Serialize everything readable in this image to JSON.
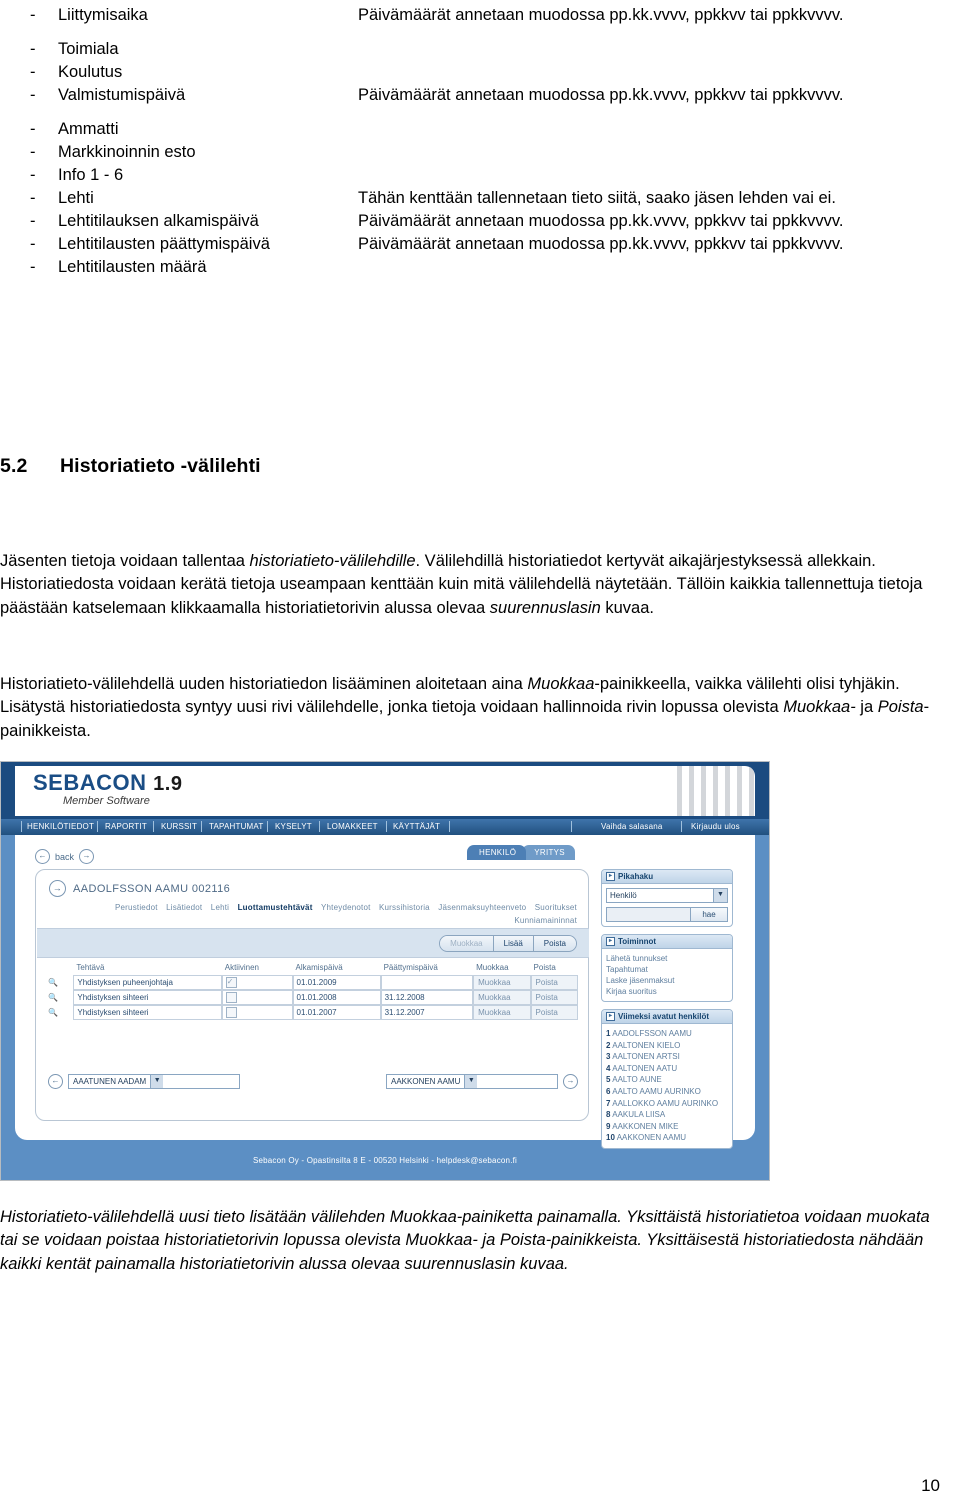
{
  "field_list": [
    {
      "dash": "-",
      "label": "Liittymisaika",
      "desc": "Päivämäärät annetaan muodossa pp.kk.vvvv, ppkkvv tai ppkkvvvv."
    },
    {
      "dash": "-",
      "label": "Toimiala",
      "desc": ""
    },
    {
      "dash": "-",
      "label": "Koulutus",
      "desc": ""
    },
    {
      "dash": "-",
      "label": "Valmistumispäivä",
      "desc": "Päivämäärät annetaan muodossa pp.kk.vvvv, ppkkvv tai ppkkvvvv."
    },
    {
      "dash": "-",
      "label": "Ammatti",
      "desc": ""
    },
    {
      "dash": "-",
      "label": "Markkinoinnin esto",
      "desc": ""
    },
    {
      "dash": "-",
      "label": "Info 1 - 6",
      "desc": ""
    },
    {
      "dash": "-",
      "label": "Lehti",
      "desc": "Tähän kenttään tallennetaan tieto siitä, saako jäsen lehden vai ei."
    },
    {
      "dash": "-",
      "label": "Lehtitilauksen alkamispäivä",
      "desc": "Päivämäärät annetaan muodossa pp.kk.vvvv, ppkkvv tai ppkkvvvv."
    },
    {
      "dash": "-",
      "label": "Lehtitilausten päättymispäivä",
      "desc": "Päivämäärät annetaan muodossa pp.kk.vvvv, ppkkvv tai ppkkvvvv."
    },
    {
      "dash": "-",
      "label": "Lehtitilausten määrä",
      "desc": ""
    }
  ],
  "heading": {
    "number": "5.2",
    "title": "Historiatieto -välilehti"
  },
  "paragraphs": {
    "p1_a": "Jäsenten tietoja voidaan tallentaa ",
    "p1_i1": "historiatieto-välilehdille",
    "p1_b": ". Välilehdillä historiatiedot kertyvät aikajärjestyksessä allekkain. Historiatiedosta voidaan kerätä tietoja useampaan kenttään kuin mitä välilehdellä näytetään. Tällöin kaikkia tallennettuja tietoja päästään katselemaan klikkaamalla historiatietorivin alussa olevaa ",
    "p1_i2": "suurennuslasin",
    "p1_c": " kuvaa.",
    "p2_a": "Historiatieto-välilehdellä uuden historiatiedon lisääminen aloitetaan aina ",
    "p2_i1": "Muokkaa",
    "p2_b": "-painikkeella, vaikka välilehti olisi tyhjäkin. Lisätystä historiatiedosta syntyy uusi rivi välilehdelle, jonka tietoja voidaan hallinnoida rivin lopussa olevista ",
    "p2_i2": "Muokkaa-",
    "p2_c": " ja ",
    "p2_i3": "Poista",
    "p2_d": "-painikkeista."
  },
  "screenshot": {
    "logo": {
      "name": "SEBACON",
      "version": "1.9",
      "tagline": "Member Software"
    },
    "nav": {
      "left_items": [
        "HENKILÖTIEDOT",
        "RAPORTIT",
        "KURSSIT",
        "TAPAHTUMAT",
        "KYSELYT",
        "LOMAKKEET",
        "KÄYTTÄJÄT"
      ],
      "right_items": [
        "Vaihda salasana",
        "Kirjaudu ulos"
      ]
    },
    "back_label": "back",
    "entity_tabs": [
      {
        "label": "HENKILÖ",
        "active": true
      },
      {
        "label": "YRITYS",
        "active": false
      }
    ],
    "person_title": "AADOLFSSON AAMU 002116",
    "subtabs": [
      {
        "label": "Perustiedot",
        "active": false
      },
      {
        "label": "Lisätiedot",
        "active": false
      },
      {
        "label": "Lehti",
        "active": false
      },
      {
        "label": "Luottamustehtävät",
        "active": true
      },
      {
        "label": "Yhteydenotot",
        "active": false
      },
      {
        "label": "Kurssihistoria",
        "active": false
      },
      {
        "label": "Jäsenmaksuyhteenveto",
        "active": false
      },
      {
        "label": "Suoritukset",
        "active": false
      },
      {
        "label": "Kunniamaininnat",
        "active": false
      }
    ],
    "action_buttons": [
      {
        "label": "Muokkaa",
        "disabled": true
      },
      {
        "label": "Lisää",
        "disabled": false
      },
      {
        "label": "Poista",
        "disabled": false
      }
    ],
    "table": {
      "headers": [
        "Tehtävä",
        "Aktiivinen",
        "Alkamispäivä",
        "Päättymispäivä",
        "Muokkaa",
        "Poista"
      ],
      "rows": [
        {
          "tehtava": "Yhdistyksen puheenjohtaja",
          "aktiivinen": true,
          "alkamis": "01.01.2009",
          "paattymis": "",
          "muokkaa": "Muokkaa",
          "poista": "Poista"
        },
        {
          "tehtava": "Yhdistyksen sihteeri",
          "aktiivinen": false,
          "alkamis": "01.01.2008",
          "paattymis": "31.12.2008",
          "muokkaa": "Muokkaa",
          "poista": "Poista"
        },
        {
          "tehtava": "Yhdistyksen sihteeri",
          "aktiivinen": false,
          "alkamis": "01.01.2007",
          "paattymis": "31.12.2007",
          "muokkaa": "Muokkaa",
          "poista": "Poista"
        }
      ]
    },
    "prev_select": "AAATUNEN AADAM",
    "next_select": "AAKKONEN AAMU",
    "panels": {
      "pikahaku": {
        "title": "Pikahaku",
        "select_value": "Henkilö",
        "search_value": "",
        "button": "hae"
      },
      "toiminnot": {
        "title": "Toiminnot",
        "links": [
          "Lähetä tunnukset",
          "Tapahtumat",
          "Laske jäsenmaksut",
          "Kirjaa suoritus"
        ]
      },
      "recent": {
        "title": "Viimeksi avatut henkilöt",
        "items": [
          {
            "n": "1",
            "name": "AADOLFSSON AAMU"
          },
          {
            "n": "2",
            "name": "AALTONEN KIELO"
          },
          {
            "n": "3",
            "name": "AALTONEN ARTSI"
          },
          {
            "n": "4",
            "name": "AALTONEN AATU"
          },
          {
            "n": "5",
            "name": "AALTO AUNE"
          },
          {
            "n": "6",
            "name": "AALTO AAMU AURINKO"
          },
          {
            "n": "7",
            "name": "AALLOKKO AAMU AURINKO"
          },
          {
            "n": "8",
            "name": "AAKULA LIISA"
          },
          {
            "n": "9",
            "name": "AAKKONEN MIKE"
          },
          {
            "n": "10",
            "name": "AAKKONEN AAMU"
          }
        ]
      }
    },
    "footer": "Sebacon Oy - Opastinsilta 8 E - 00520 Helsinki - helpdesk@sebacon.fi"
  },
  "caption": {
    "text": "Historiatieto-välilehdellä uusi tieto lisätään välilehden Muokkaa-painiketta painamalla. Yksittäistä historiatietoa voidaan muokata tai se voidaan poistaa historiatietorivin lopussa olevista Muokkaa- ja Poista-painikkeista. Yksittäisestä historiatiedosta nähdään kaikki kentät painamalla historiatietorivin alussa olevaa suurennuslasin kuvaa."
  },
  "page_number": "10",
  "colors": {
    "nav_blue": "#2c5c8f",
    "brand_blue": "#1a4d85",
    "body_blue": "#5c8fc4"
  }
}
